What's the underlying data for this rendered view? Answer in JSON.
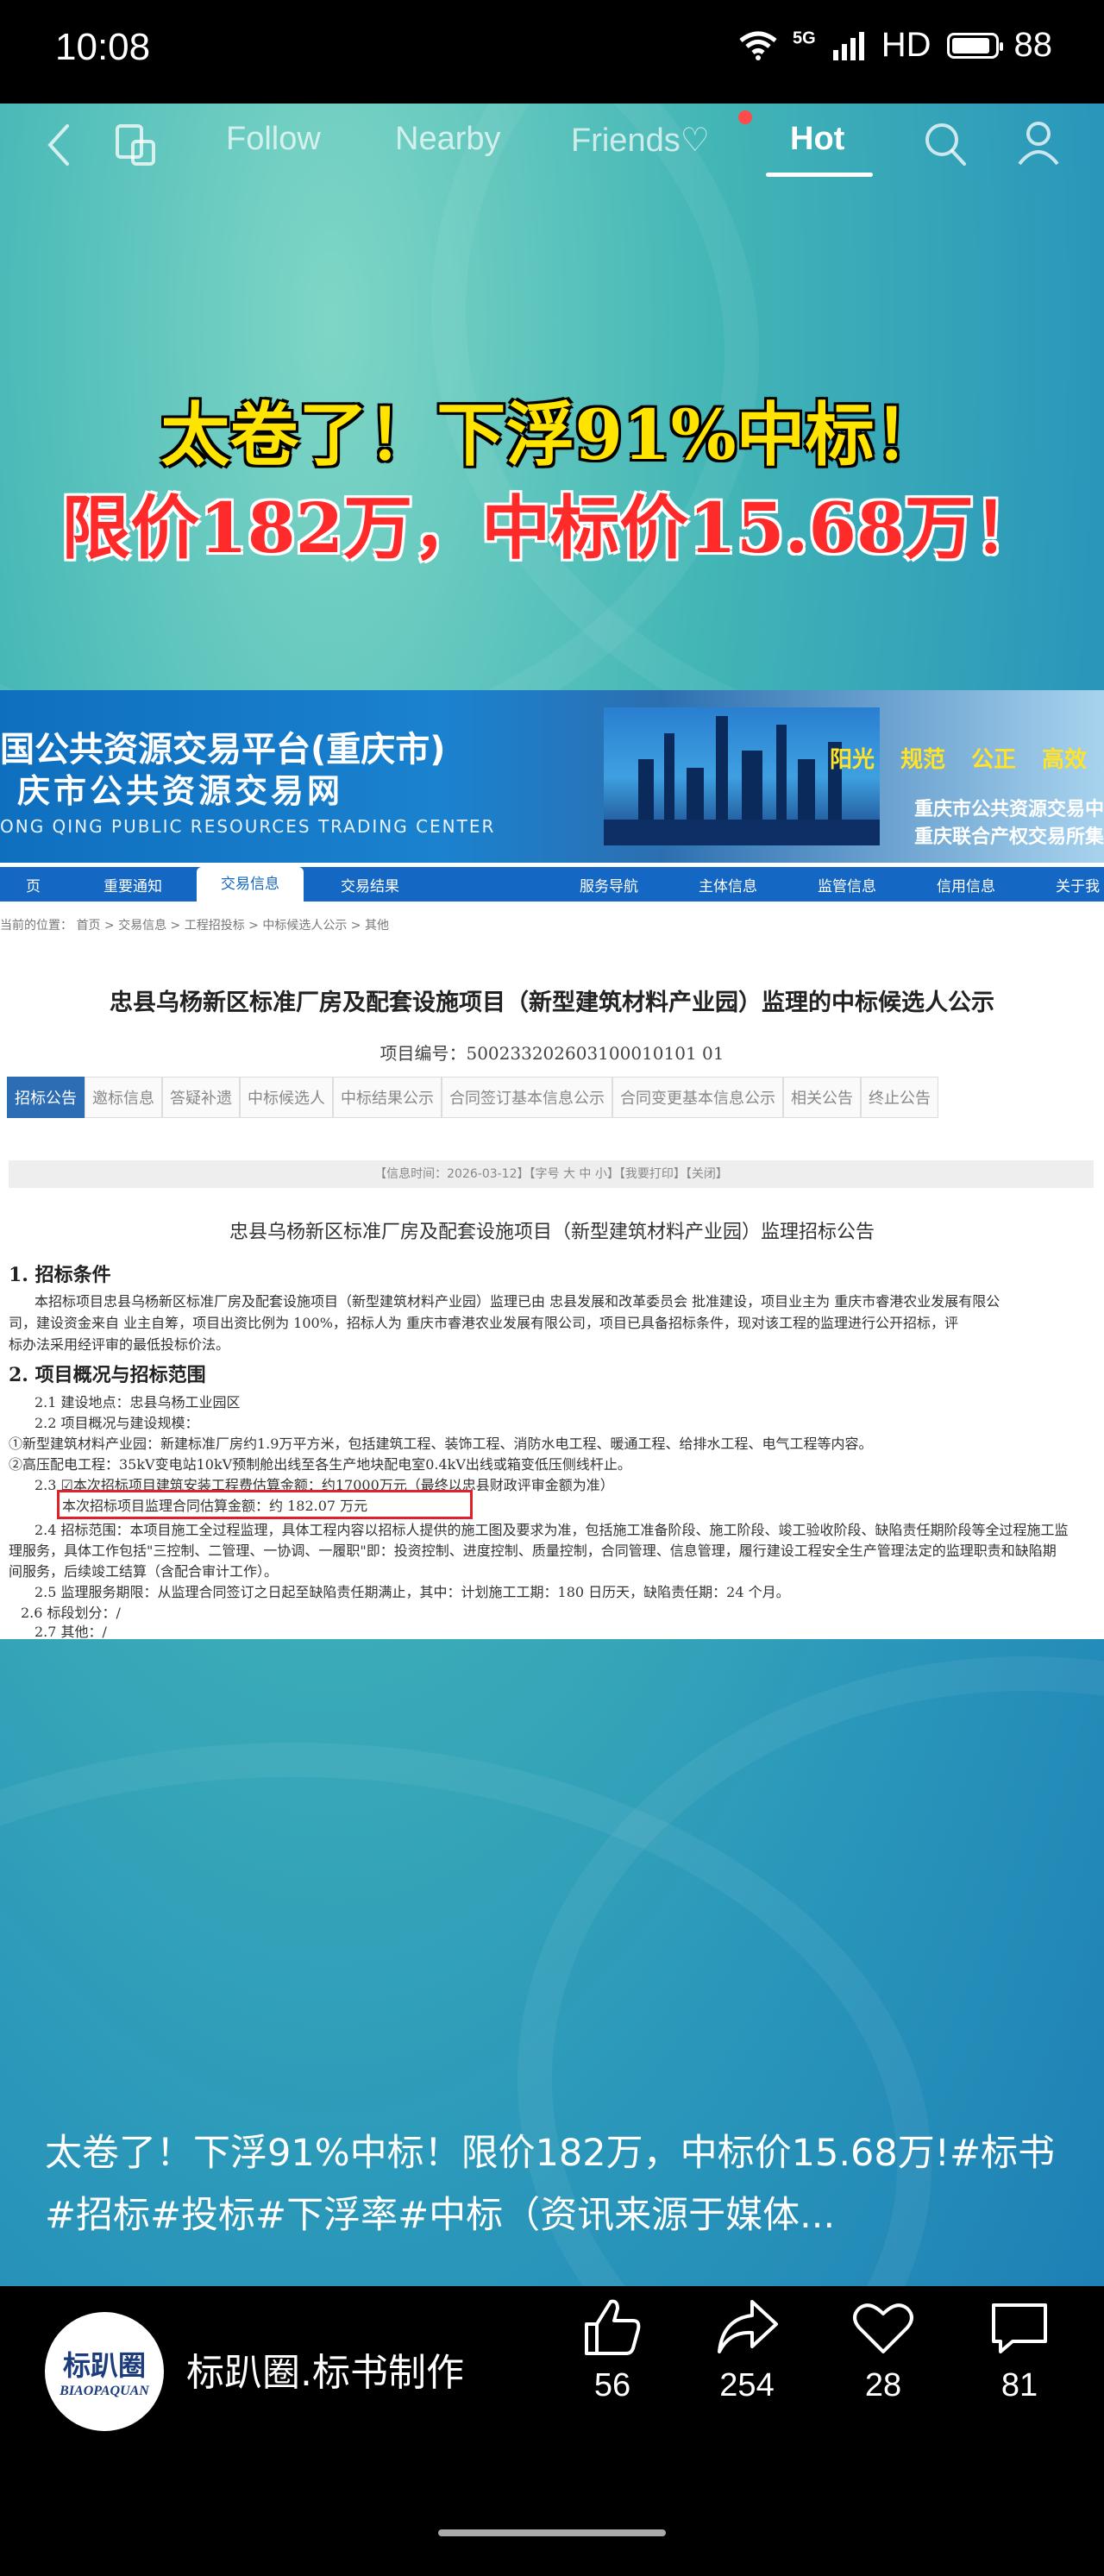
{
  "status_bar": {
    "time": "10:08",
    "network": "5G",
    "hd": "HD",
    "battery": "88"
  },
  "top_nav": {
    "tabs": [
      {
        "label": "Follow"
      },
      {
        "label": "Nearby"
      },
      {
        "label": "Friends"
      },
      {
        "label": "Hot"
      }
    ],
    "active_tab": "Hot"
  },
  "video": {
    "headline_1": "太卷了！下浮91%中标！",
    "headline_2": "限价182万，中标价15.68万！",
    "document": {
      "platform_title": "国公共资源交易平台(重庆市)",
      "platform_sub": "庆市公共资源交易网",
      "platform_en": "ONG QING PUBLIC RESOURCES TRADING CENTER",
      "slogan": [
        "阳光",
        "规范",
        "公正",
        "高效"
      ],
      "partner_1": "重庆市公共资源交易中",
      "partner_2": "重庆联合产权交易所集",
      "menu": [
        "页",
        "重要通知",
        "交易信息",
        "交易结果",
        "服务导航",
        "主体信息",
        "监管信息",
        "信用信息",
        "关于我"
      ],
      "breadcrumb": "当前的位置： 首页 > 交易信息 > 工程招投标 > 中标候选人公示 > 其他",
      "title": "忠县乌杨新区标准厂房及配套设施项目（新型建筑材料产业园）监理的中标候选人公示",
      "project_no": "项目编号：500233202603100010101 01",
      "tabs": [
        "招标公告",
        "邀标信息",
        "答疑补遗",
        "中标候选人",
        "中标结果公示",
        "合同签订基本信息公示",
        "合同变更基本信息公示",
        "相关公告",
        "终止公告"
      ],
      "info_bar": "【信息时间：2026-03-12】【字号 大 中 小】【我要打印】【关闭】",
      "announce_title": "忠县乌杨新区标准厂房及配套设施项目（新型建筑材料产业园）监理招标公告",
      "sections": [
        "1. 招标条件",
        "本招标项目忠县乌杨新区标准厂房及配套设施项目（新型建筑材料产业园）监理已由 忠县发展和改革委员会 批准建设，项目业主为 重庆市睿港农业发展有限公",
        "司，建设资金来自 业主自筹，项目出资比例为 100%，招标人为 重庆市睿港农业发展有限公司，项目已具备招标条件，现对该工程的监理进行公开招标，评",
        "标办法采用经评审的最低投标价法。",
        "2. 项目概况与招标范围",
        "2.1 建设地点：忠县乌杨工业园区",
        "2.2 项目概况与建设规模：",
        "①新型建筑材料产业园：新建标准厂房约1.9万平方米，包括建筑工程、装饰工程、消防水电工程、暖通工程、给排水工程、电气工程等内容。",
        "②高压配电工程：35kV变电站10kV预制舱出线至各生产地块配电室0.4kV出线或箱变低压侧线杆止。",
        "2.3 ☑本次招标项目建筑安装工程费估算金额：约17000万元（最终以忠县财政评审金额为准）",
        "本次招标项目监理合同估算金额：约 182.07 万元",
        "2.4 招标范围：本项目施工全过程监理，具体工程内容以招标人提供的施工图及要求为准，包括施工准备阶段、施工阶段、竣工验收阶段、缺陷责任期阶段等全过程施工监",
        "理服务，具体工作包括\"三控制、二管理、一协调、一履职\"即：投资控制、进度控制、质量控制，合同管理、信息管理，履行建设工程安全生产管理法定的监理职责和缺陷期",
        "间服务，后续竣工结算（含配合审计工作）。",
        "2.5 监理服务期限：从监理合同签订之日起至缺陷责任期满止，其中：计划施工工期：180 日历天，缺陷责任期：24 个月。",
        "2.6 标段划分：/",
        "2.7 其他：/"
      ]
    }
  },
  "caption": "太卷了！下浮91%中标！限价182万，中标价15.68万!#标书#招标#投标#下浮率#中标（资讯来源于媒体...",
  "author": {
    "name": "标趴圈.标书制作",
    "avatar_cn": "标趴圈",
    "avatar_en": "BIAOPAQUAN"
  },
  "actions": {
    "like": "56",
    "share": "254",
    "favorite": "28",
    "comment": "81"
  }
}
